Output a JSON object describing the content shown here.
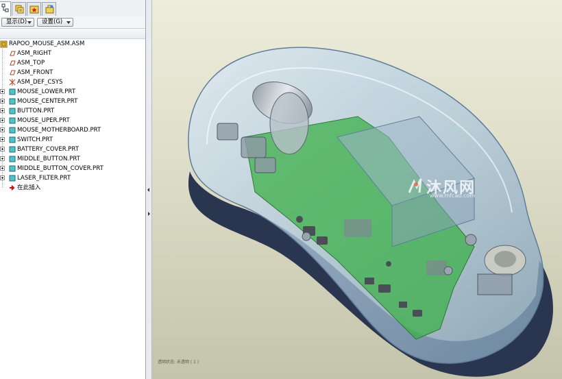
{
  "tabs": [
    {
      "icon": "model-tree-icon"
    },
    {
      "icon": "layers-icon"
    },
    {
      "icon": "folder-star-icon"
    },
    {
      "icon": "favorites-icon"
    }
  ],
  "toolbar": {
    "show_label": "显示(D)",
    "settings_label": "设置(G)"
  },
  "tree": {
    "root": "RAPOO_MOUSE_ASM.ASM",
    "datums": [
      "ASM_RIGHT",
      "ASM_TOP",
      "ASM_FRONT"
    ],
    "csys": "ASM_DEF_CSYS",
    "parts": [
      "MOUSE_LOWER.PRT",
      "MOUSE_CENTER.PRT",
      "BUTTON.PRT",
      "MOUSE_UPER.PRT",
      "MOUSE_MOTHERBOARD.PRT",
      "SWITCH.PRT",
      "BATTERY_COVER.PRT",
      "MIDDLE_BUTTON.PRT",
      "MIDDLE_BUTTON_COVER.PRT",
      "LASER_FILTER.PRT"
    ],
    "insert_here": "在此插入"
  },
  "viewport": {
    "status": "透明状态: 未透明 ( 1 )",
    "watermark_brand": "沐风网",
    "watermark_url": "www.mfcad.com"
  },
  "colors": {
    "background_top": "#ededdc",
    "background_bottom": "#c4c4ac",
    "shell": "#aec8dc",
    "pcb": "#3cb04a",
    "base": "#2a3550",
    "insert_arrow": "#d01010"
  }
}
